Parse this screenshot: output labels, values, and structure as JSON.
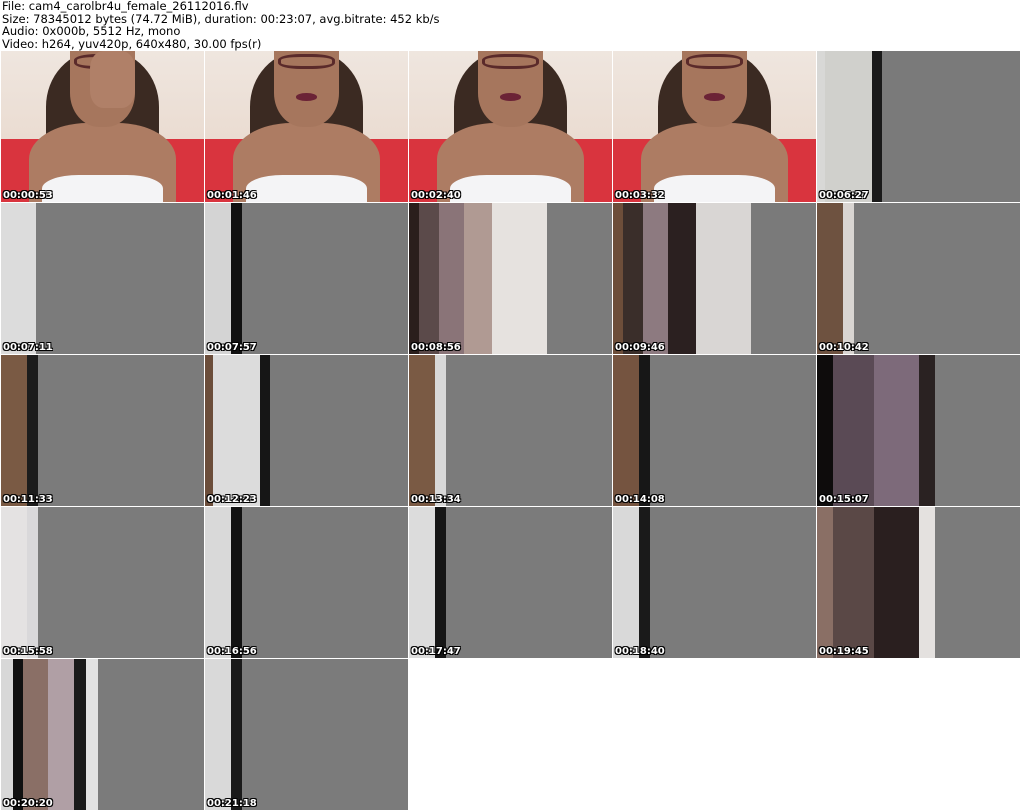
{
  "header": {
    "file_line": "File: cam4_carolbr4u_female_26112016.flv",
    "size_line": "Size: 78345012 bytes (74.72 MiB), duration: 00:23:07, avg.bitrate: 452 kb/s",
    "audio_line": "Audio: 0x000b, 5512 Hz, mono",
    "video_line": "Video: h264, yuv420p, 640x480, 30.00 fps(r)"
  },
  "thumbnails": [
    {
      "timestamp": "00:00:53",
      "kind": "cam"
    },
    {
      "timestamp": "00:01:46",
      "kind": "cam"
    },
    {
      "timestamp": "00:02:40",
      "kind": "cam"
    },
    {
      "timestamp": "00:03:32",
      "kind": "cam"
    },
    {
      "timestamp": "00:06:27",
      "kind": "bars",
      "bars": [
        "#d8d8d6",
        "#d0d0cc",
        "#1a1a1a",
        "#7a7a7a"
      ]
    },
    {
      "timestamp": "00:07:11",
      "kind": "bars",
      "bars": [
        "#dcdcdc",
        "#7b7b7b"
      ]
    },
    {
      "timestamp": "00:07:57",
      "kind": "bars",
      "bars": [
        "#d4d4d4",
        "#111111",
        "#7a7a7a"
      ]
    },
    {
      "timestamp": "00:08:56",
      "kind": "bars",
      "bars": [
        "#2a1e1c",
        "#5b4a4a",
        "#8a7478",
        "#b09a93",
        "#e6e2df",
        "#7b7b7b"
      ]
    },
    {
      "timestamp": "00:09:46",
      "kind": "bars",
      "bars": [
        "#6d4e3a",
        "#3a2e2a",
        "#8d7a80",
        "#2b2020",
        "#d9d6d4",
        "#7a7a7a"
      ]
    },
    {
      "timestamp": "00:10:42",
      "kind": "bars",
      "bars": [
        "#6e5240",
        "#d9d5d2",
        "#7b7b7b"
      ]
    },
    {
      "timestamp": "00:11:33",
      "kind": "bars",
      "bars": [
        "#7a5a44",
        "#1c1c1c",
        "#7b7b7b"
      ]
    },
    {
      "timestamp": "00:12:23",
      "kind": "bars",
      "bars": [
        "#6b4d3a",
        "#dcdcdc",
        "#161616",
        "#7a7a7a"
      ]
    },
    {
      "timestamp": "00:13:34",
      "kind": "bars",
      "bars": [
        "#7a5a44",
        "#d8d8d8",
        "#7b7b7b"
      ]
    },
    {
      "timestamp": "00:14:08",
      "kind": "bars",
      "bars": [
        "#755440",
        "#171717",
        "#7b7b7b"
      ]
    },
    {
      "timestamp": "00:15:07",
      "kind": "bars",
      "bars": [
        "#0e0c0c",
        "#5a4a55",
        "#7d6a7a",
        "#2a2222",
        "#7b7b7b"
      ]
    },
    {
      "timestamp": "00:15:58",
      "kind": "bars",
      "bars": [
        "#e4e2e2",
        "#d9d8da",
        "#7b7b7b"
      ]
    },
    {
      "timestamp": "00:16:56",
      "kind": "bars",
      "bars": [
        "#d9d9d9",
        "#121212",
        "#7a7a7a"
      ]
    },
    {
      "timestamp": "00:17:47",
      "kind": "bars",
      "bars": [
        "#dcdcdc",
        "#161616",
        "#7b7b7b"
      ]
    },
    {
      "timestamp": "00:18:40",
      "kind": "bars",
      "bars": [
        "#d9d9d9",
        "#1a1a1a",
        "#7b7b7b"
      ]
    },
    {
      "timestamp": "00:19:45",
      "kind": "bars",
      "bars": [
        "#8a6f65",
        "#5a4846",
        "#2a1f1f",
        "#e4e1df",
        "#7b7b7b"
      ]
    },
    {
      "timestamp": "00:20:20",
      "kind": "bars",
      "bars": [
        "#d8d8d8",
        "#111111",
        "#8a6f66",
        "#b09fa5",
        "#1a1a1a",
        "#e2e2e2",
        "#7b7b7b"
      ]
    },
    {
      "timestamp": "00:21:18",
      "kind": "bars",
      "bars": [
        "#d9d9d9",
        "#1a1a1a",
        "#7b7b7b"
      ]
    }
  ]
}
